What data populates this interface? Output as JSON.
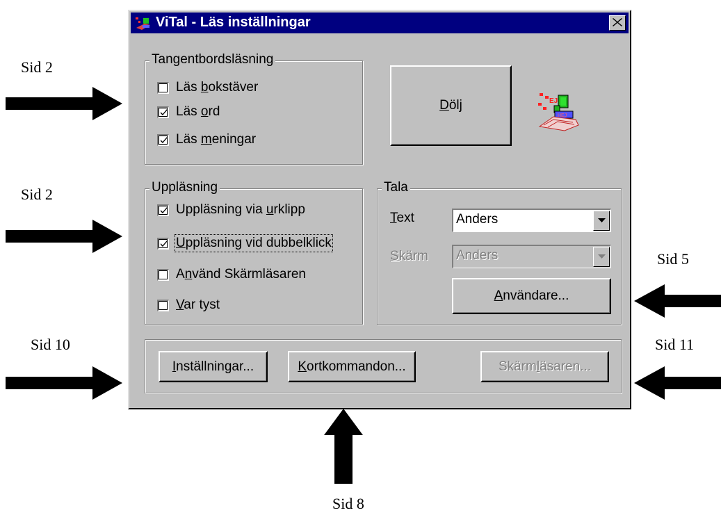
{
  "window": {
    "title": "ViTal - Läs inställningar",
    "close_glyph": "✕"
  },
  "keyboard_group": {
    "legend": "Tangentbordsläsning",
    "items": [
      {
        "pre": "Läs ",
        "u": "b",
        "post": "okstäver",
        "checked": false
      },
      {
        "pre": "Läs ",
        "u": "o",
        "post": "rd",
        "checked": true
      },
      {
        "pre": "Läs ",
        "u": "m",
        "post": "eningar",
        "checked": true
      }
    ]
  },
  "hide_button": {
    "u": "D",
    "post": "ölj"
  },
  "reading_group": {
    "legend": "Uppläsning",
    "items": [
      {
        "pre": "Uppläsning via ",
        "u": "u",
        "post": "rklipp",
        "checked": true
      },
      {
        "pre": "",
        "u": "U",
        "post": "ppläsning vid dubbelklick",
        "checked": true
      },
      {
        "pre": "A",
        "u": "n",
        "post": "vänd Skärmläsaren",
        "checked": false
      },
      {
        "pre": "",
        "u": "V",
        "post": "ar tyst",
        "checked": false
      }
    ]
  },
  "speak_group": {
    "legend": "Tala",
    "text_label": {
      "u": "T",
      "post": "ext"
    },
    "text_value": "Anders",
    "screen_label": {
      "u": "S",
      "post": "kärm"
    },
    "screen_value": "Anders",
    "users_button": {
      "u": "A",
      "post": "nvändare..."
    }
  },
  "bottom_buttons": {
    "settings": {
      "u": "I",
      "post": "nställningar..."
    },
    "shortcuts": {
      "u": "K",
      "post": "ortkommandon..."
    },
    "screenreader": {
      "pre": "Skärm",
      "u": "l",
      "post": "äsaren..."
    }
  },
  "annotations": {
    "sid2_top": "Sid 2",
    "sid2_mid": "Sid 2",
    "sid5": "Sid 5",
    "sid10": "Sid 10",
    "sid11": "Sid 11",
    "sid8": "Sid 8"
  },
  "icons": {
    "app_icon": "vital-app-icon",
    "arrow": "arrow-icon",
    "check": "checkmark-icon",
    "dropdown": "chevron-down-icon"
  }
}
